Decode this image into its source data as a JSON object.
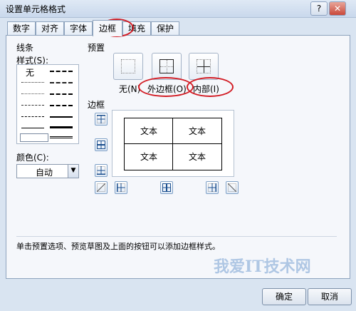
{
  "window": {
    "title": "设置单元格格式",
    "help": "?",
    "close": "✕"
  },
  "tabs": [
    {
      "label": "数字"
    },
    {
      "label": "对齐"
    },
    {
      "label": "字体"
    },
    {
      "label": "边框",
      "active": true
    },
    {
      "label": "填充"
    },
    {
      "label": "保护"
    }
  ],
  "line": {
    "group_label": "线条",
    "style_label": "样式(S):",
    "none_label": "无",
    "color_label": "颜色(C):",
    "color_value": "自动"
  },
  "presets": {
    "group_label": "预置",
    "none_label": "无(N)",
    "outline_label": "外边框(O)",
    "inside_label": "内部(I)"
  },
  "border": {
    "group_label": "边框",
    "preview_cells": [
      "文本",
      "文本",
      "文本",
      "文本"
    ]
  },
  "hint": "单击预置选项、预览草图及上面的按钮可以添加边框样式。",
  "buttons": {
    "ok": "确定",
    "cancel": "取消"
  },
  "watermark": "我爱IT技术网",
  "colors": {
    "highlight_ellipse": "#d21c24",
    "accent": "#7ea0c6"
  }
}
